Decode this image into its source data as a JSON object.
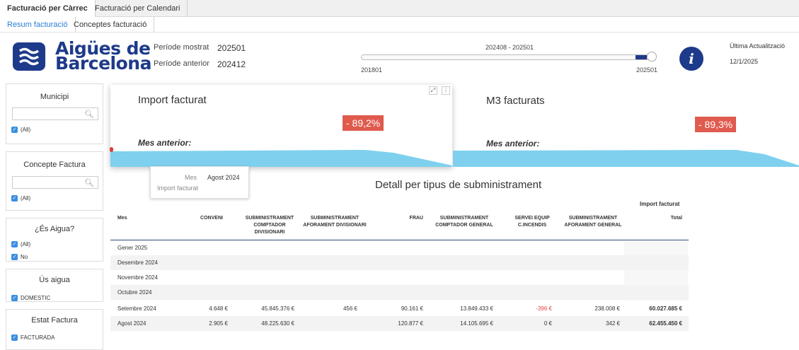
{
  "tabs_top": [
    "Facturació per Càrrec",
    "Facturació per Calendari"
  ],
  "tabs_sub": [
    "Resum facturació",
    "Conceptes facturació"
  ],
  "logo": {
    "line1": "Aigües de",
    "line2": "Barcelona",
    "icon": "agbar-waves-logo"
  },
  "period": {
    "shown_label": "Període mostrat",
    "shown_value": "202501",
    "previous_label": "Període anterior",
    "previous_value": "202412"
  },
  "slider": {
    "range_label": "202408 - 202501",
    "min_label": "201801",
    "max_label": "202501"
  },
  "info_icon": "info-icon",
  "last_update": {
    "label": "Última Actualització",
    "date": "12/1/2025"
  },
  "filters": [
    {
      "title": "Municipi",
      "options": [
        "(All)"
      ]
    },
    {
      "title": "Concepte Factura",
      "options": [
        "(All)"
      ]
    },
    {
      "title": "¿És Aigua?",
      "options": [
        "(All)",
        "No"
      ]
    },
    {
      "title": "Ús aigua",
      "options": [
        "DOMESTIC"
      ]
    },
    {
      "title": "Estat Factura",
      "options": [
        "FACTURADA"
      ]
    }
  ],
  "kpi_cards": [
    {
      "title": "Import facturat",
      "change": "- 89,2%",
      "previous_label": "Mes anterior:"
    },
    {
      "title": "M3 facturats",
      "change": "- 89,3%",
      "previous_label": "Mes anterior:"
    }
  ],
  "card_controls": {
    "expand": "expand-icon",
    "menu": "more-options-icon"
  },
  "tooltip": {
    "mes_label": "Mes",
    "mes_value": "Agost 2024",
    "import_label": "Import facturat"
  },
  "detail": {
    "title": "Detall per tipus de subministrament",
    "group_header": "Import facturat",
    "columns": [
      "Mes",
      "CONVENI",
      "SUBMINISTRAMENT COMPTADOR DIVISIONARI",
      "SUBMINISTRAMENT AFORAMENT DIVISIONARI",
      "FRAU",
      "SUBMINISTRAMENT COMPTADOR GENERAL",
      "SERVEI EQUIP C.INCENDIS",
      "SUBMINISTRAMENT AFORAMENT GENERAL",
      "Total"
    ],
    "rows": [
      [
        "Gener 2025",
        "",
        "",
        "",
        "",
        "",
        "",
        "",
        ""
      ],
      [
        "Desembre 2024",
        "",
        "",
        "",
        "",
        "",
        "",
        "",
        ""
      ],
      [
        "Novembre 2024",
        "",
        "",
        "",
        "",
        "",
        "",
        "",
        ""
      ],
      [
        "Octubre 2024",
        "",
        "",
        "",
        "",
        "",
        "",
        "",
        ""
      ],
      [
        "Setembre 2024",
        "4.648 €",
        "45.845.376 €",
        "456 €",
        "90.161 €",
        "13.849.433 €",
        "-396 €",
        "238.008 €",
        "60.027.685 €"
      ],
      [
        "Agost 2024",
        "2.905 €",
        "48.225.630 €",
        "",
        "120.877 €",
        "14.105.695 €",
        "0 €",
        "342 €",
        "62.455.450 €"
      ]
    ],
    "negative_color": "#e0463c"
  },
  "colors": {
    "brand": "#1e3a8a",
    "accent": "#2a7fd4",
    "kpi_negative": "#e05a4e",
    "wave": "#7fd0ee"
  }
}
